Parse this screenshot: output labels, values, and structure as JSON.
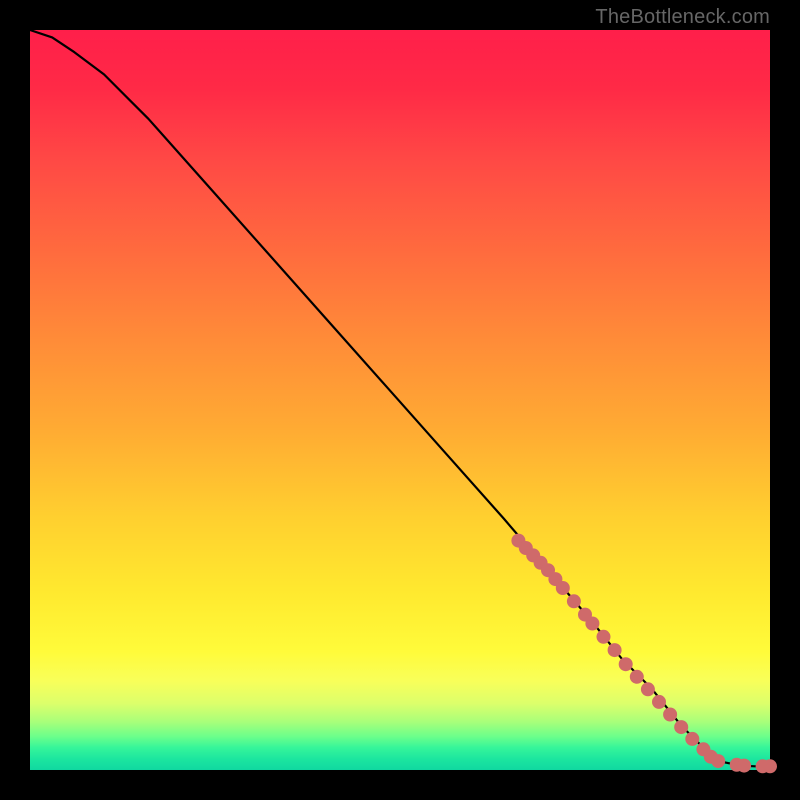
{
  "watermark": "TheBottleneck.com",
  "colors": {
    "dot": "#cf6a6a",
    "curve": "#000000",
    "gradient_top": "#ff1f4a",
    "gradient_bottom": "#10d8a0",
    "page_bg": "#000000"
  },
  "chart_data": {
    "type": "line",
    "title": "",
    "xlabel": "",
    "ylabel": "",
    "xlim": [
      0,
      100
    ],
    "ylim": [
      0,
      100
    ],
    "grid": false,
    "legend": false,
    "series": [
      {
        "name": "curve",
        "x": [
          0,
          3,
          6,
          10,
          16,
          24,
          32,
          40,
          48,
          56,
          64,
          70,
          76,
          80,
          84,
          88,
          90,
          92,
          94,
          96,
          98,
          100
        ],
        "y": [
          100,
          99,
          97,
          94,
          88,
          79,
          70,
          61,
          52,
          43,
          34,
          27,
          20,
          15,
          11,
          6,
          4,
          2,
          1,
          0.6,
          0.5,
          0.5
        ]
      }
    ],
    "points": [
      {
        "name": "cluster",
        "x": 66,
        "y": 31
      },
      {
        "name": "cluster",
        "x": 67,
        "y": 30
      },
      {
        "name": "cluster",
        "x": 68,
        "y": 29
      },
      {
        "name": "cluster",
        "x": 69,
        "y": 28
      },
      {
        "name": "cluster",
        "x": 70,
        "y": 27
      },
      {
        "name": "cluster",
        "x": 71,
        "y": 25.8
      },
      {
        "name": "cluster",
        "x": 72,
        "y": 24.6
      },
      {
        "name": "cluster",
        "x": 73.5,
        "y": 22.8
      },
      {
        "name": "cluster",
        "x": 75,
        "y": 21
      },
      {
        "name": "cluster",
        "x": 76,
        "y": 19.8
      },
      {
        "name": "cluster",
        "x": 77.5,
        "y": 18
      },
      {
        "name": "cluster",
        "x": 79,
        "y": 16.2
      },
      {
        "name": "cluster",
        "x": 80.5,
        "y": 14.3
      },
      {
        "name": "cluster",
        "x": 82,
        "y": 12.6
      },
      {
        "name": "cluster",
        "x": 83.5,
        "y": 10.9
      },
      {
        "name": "cluster",
        "x": 85,
        "y": 9.2
      },
      {
        "name": "cluster",
        "x": 86.5,
        "y": 7.5
      },
      {
        "name": "cluster",
        "x": 88,
        "y": 5.8
      },
      {
        "name": "cluster",
        "x": 89.5,
        "y": 4.2
      },
      {
        "name": "tail",
        "x": 91,
        "y": 2.8
      },
      {
        "name": "tail",
        "x": 92,
        "y": 1.8
      },
      {
        "name": "tail",
        "x": 93,
        "y": 1.2
      },
      {
        "name": "tail",
        "x": 95.5,
        "y": 0.7
      },
      {
        "name": "tail",
        "x": 96.5,
        "y": 0.6
      },
      {
        "name": "tail",
        "x": 99,
        "y": 0.5
      },
      {
        "name": "tail",
        "x": 100,
        "y": 0.5
      }
    ],
    "point_radius_px": 7
  }
}
